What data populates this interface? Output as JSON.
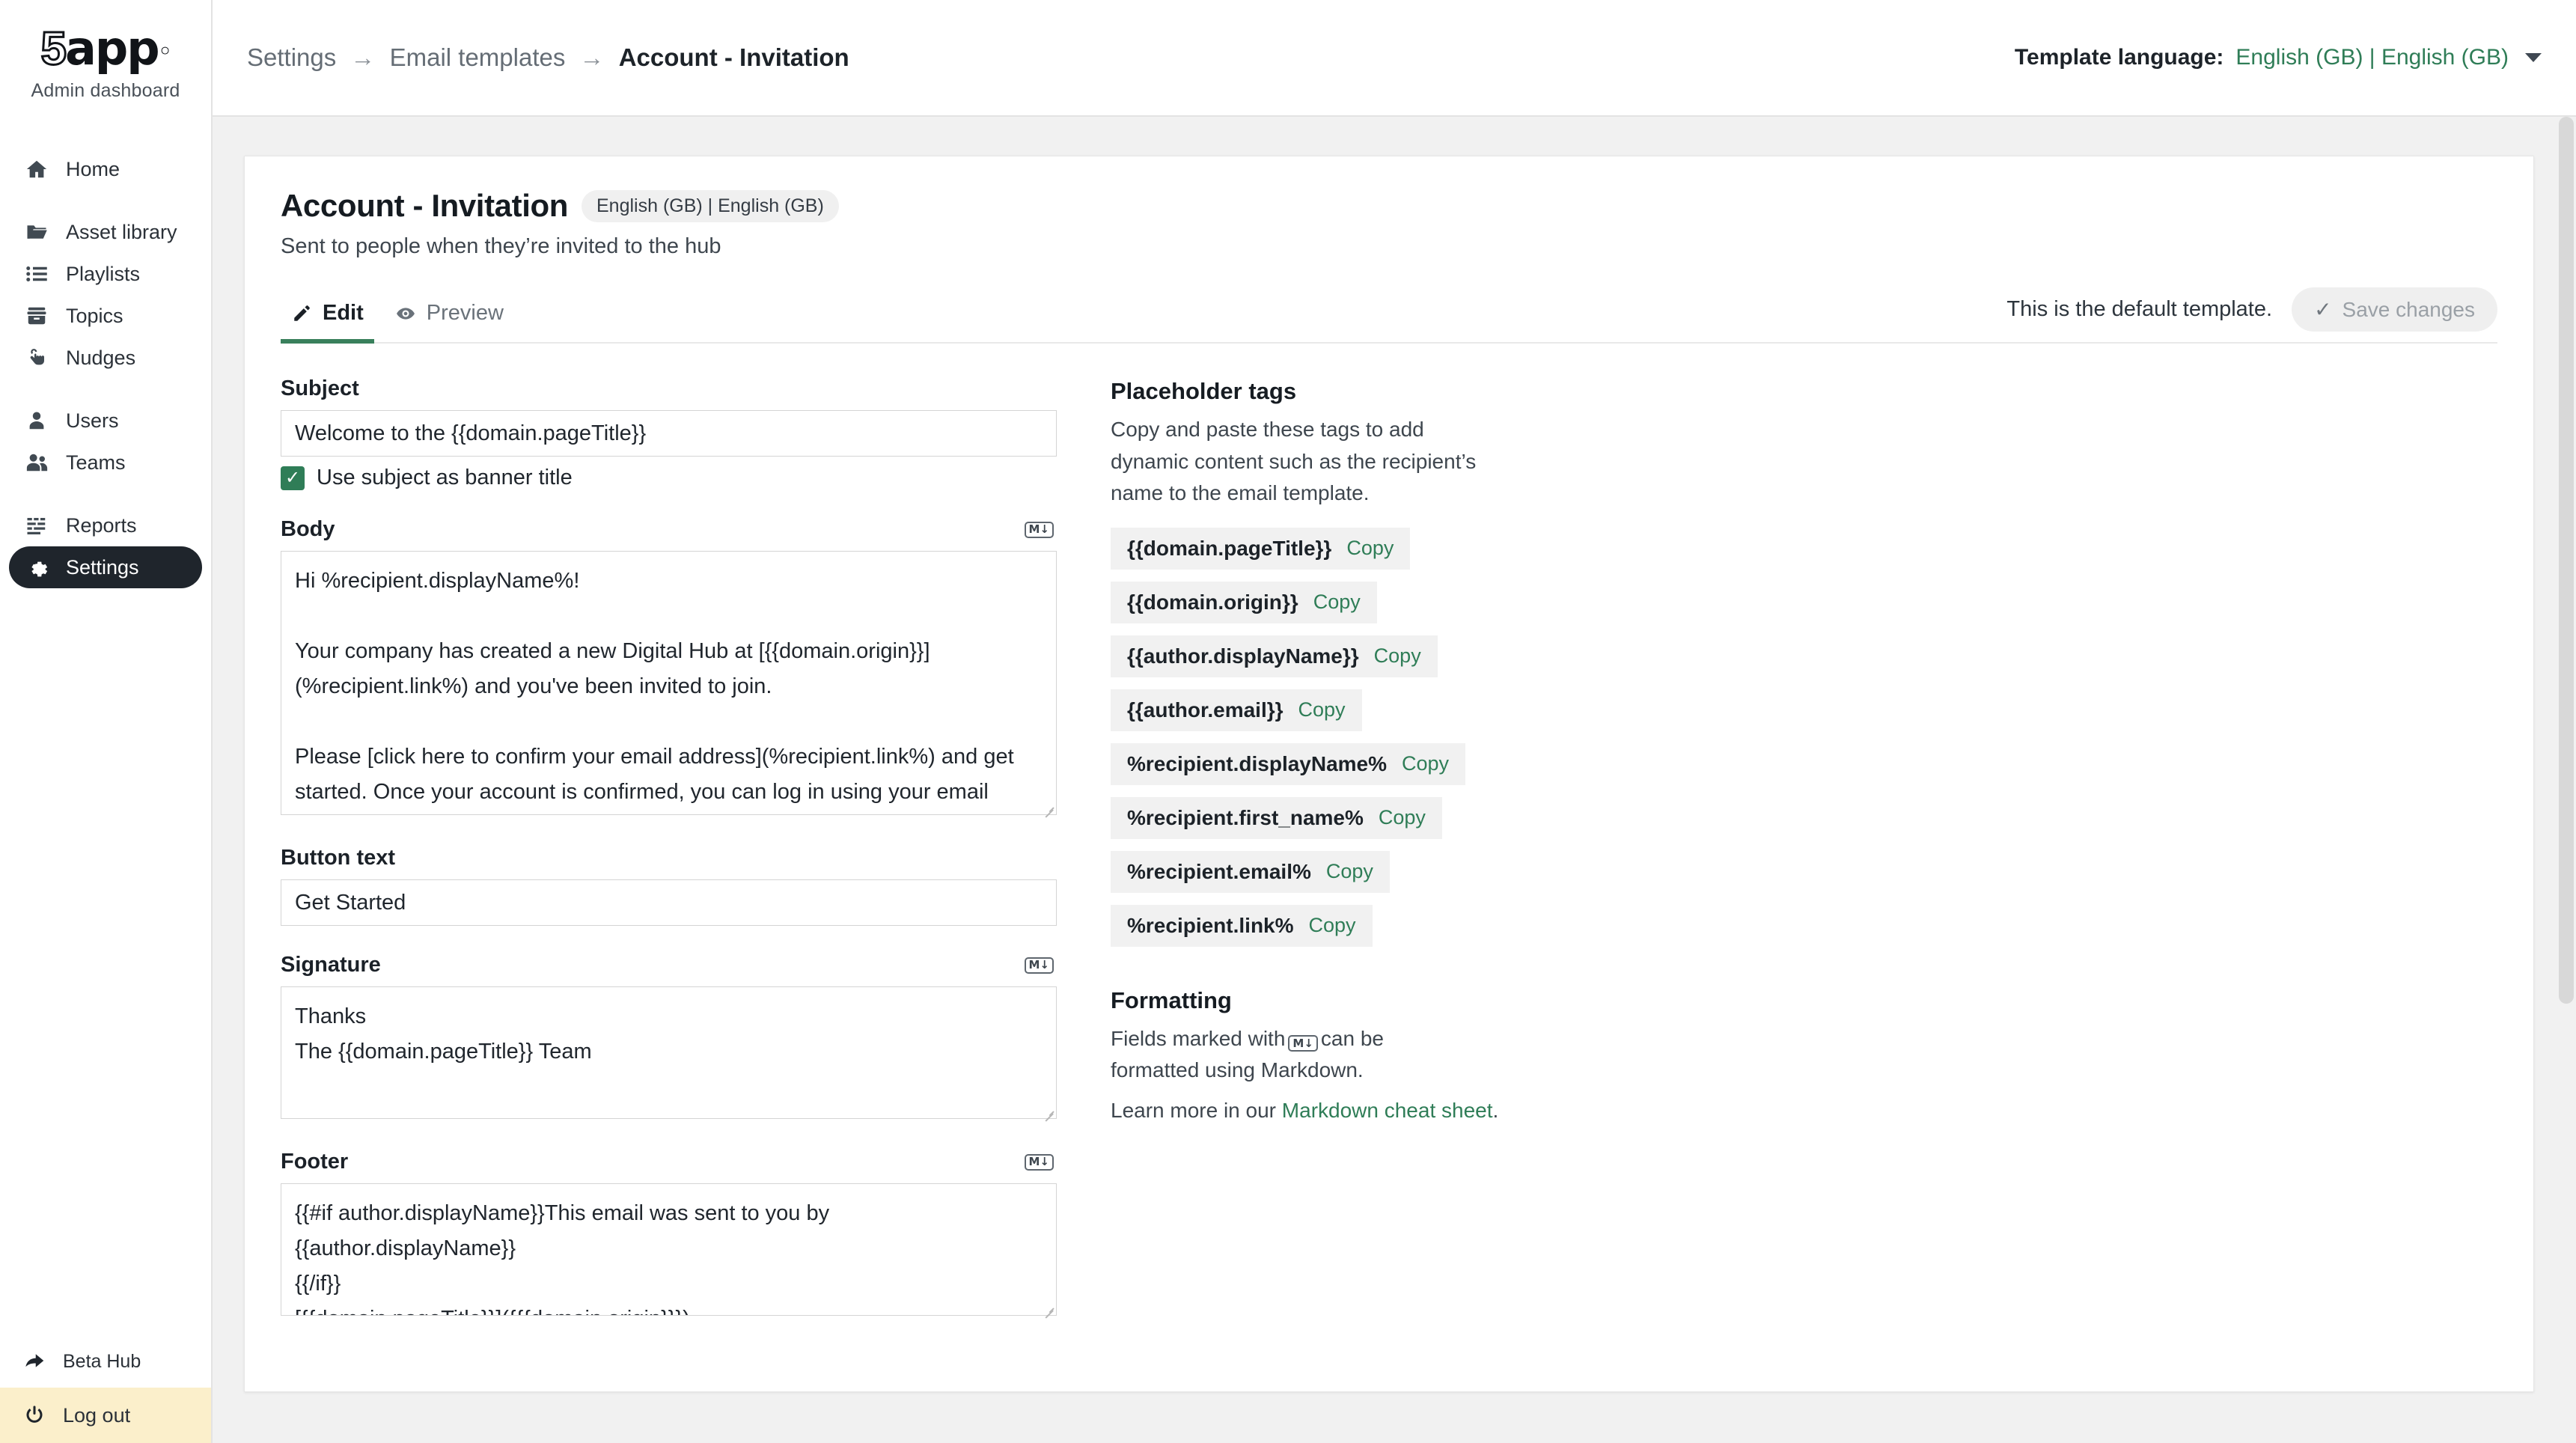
{
  "sidebar": {
    "logo_five": "5",
    "logo_rest": "app",
    "logo_dot": "◦",
    "subtitle": "Admin dashboard",
    "groups": [
      {
        "items": [
          {
            "label": "Home",
            "icon": "home-icon"
          }
        ]
      },
      {
        "items": [
          {
            "label": "Asset library",
            "icon": "folder-icon"
          },
          {
            "label": "Playlists",
            "icon": "list-icon"
          },
          {
            "label": "Topics",
            "icon": "archive-icon"
          },
          {
            "label": "Nudges",
            "icon": "hand-pointer-icon"
          }
        ]
      },
      {
        "items": [
          {
            "label": "Users",
            "icon": "user-icon"
          },
          {
            "label": "Teams",
            "icon": "users-icon"
          }
        ]
      },
      {
        "items": [
          {
            "label": "Reports",
            "icon": "bars-icon"
          },
          {
            "label": "Settings",
            "icon": "gear-icon",
            "active": true
          }
        ]
      }
    ],
    "beta_hub": "Beta Hub",
    "logout": "Log out"
  },
  "topbar": {
    "breadcrumb": [
      "Settings",
      "Email templates",
      "Account - Invitation"
    ],
    "separator": "→",
    "language_label": "Template language:",
    "language_value": "English (GB) | English (GB)"
  },
  "page": {
    "title": "Account - Invitation",
    "language_chip": "English (GB) | English (GB)",
    "subtitle": "Sent to people when they’re invited to the hub",
    "tabs": [
      {
        "label": "Edit",
        "icon": "pencil-icon",
        "active": true
      },
      {
        "label": "Preview",
        "icon": "eye-icon",
        "active": false
      }
    ],
    "default_note": "This is the default template.",
    "save_label": "Save changes",
    "save_check": "✓"
  },
  "form": {
    "subject": {
      "label": "Subject",
      "value": "Welcome to the {{domain.pageTitle}}",
      "placeholder": "Subject"
    },
    "banner_checkbox": {
      "label": "Use subject as banner title",
      "checked": true,
      "check_glyph": "✓"
    },
    "body": {
      "label": "Body",
      "markdown": true,
      "value": "Hi %recipient.displayName%!\n\nYour company has created a new Digital Hub at [{{domain.origin}}](%recipient.link%) and you've been invited to join.\n\nPlease [click here to confirm your email address](%recipient.link%) and get started. Once your account is confirmed, you can log in using your email address %recipient.email%"
    },
    "button_text": {
      "label": "Button text",
      "value": "Get Started",
      "placeholder": "Button text"
    },
    "signature": {
      "label": "Signature",
      "markdown": true,
      "value": "Thanks\nThe {{domain.pageTitle}} Team"
    },
    "footer": {
      "label": "Footer",
      "markdown": true,
      "value": "{{#if author.displayName}}This email was sent to you by {{author.displayName}}\n{{/if}}\n[{{domain.pageTitle}}]({{{domain.origin}}})"
    }
  },
  "placeholders": {
    "title": "Placeholder tags",
    "description": "Copy and paste these tags to add dynamic content such as the recipient’s name to the email template.",
    "copy_label": "Copy",
    "tags": [
      "{{domain.pageTitle}}",
      "{{domain.origin}}",
      "{{author.displayName}}",
      "{{author.email}}",
      "%recipient.displayName%",
      "%recipient.first_name%",
      "%recipient.email%",
      "%recipient.link%"
    ]
  },
  "formatting": {
    "title": "Formatting",
    "desc_before": "Fields marked with",
    "desc_after": "can be formatted using Markdown.",
    "learn_prefix": "Learn more in our ",
    "learn_link": "Markdown cheat sheet",
    "learn_suffix": "."
  },
  "icons": {
    "markdown_badge": "M↓"
  },
  "colors": {
    "accent_green": "#2f7d57",
    "tab_underline": "#39805c",
    "sidebar_active_bg": "#1f252c",
    "logout_bg": "#fbefcb"
  }
}
